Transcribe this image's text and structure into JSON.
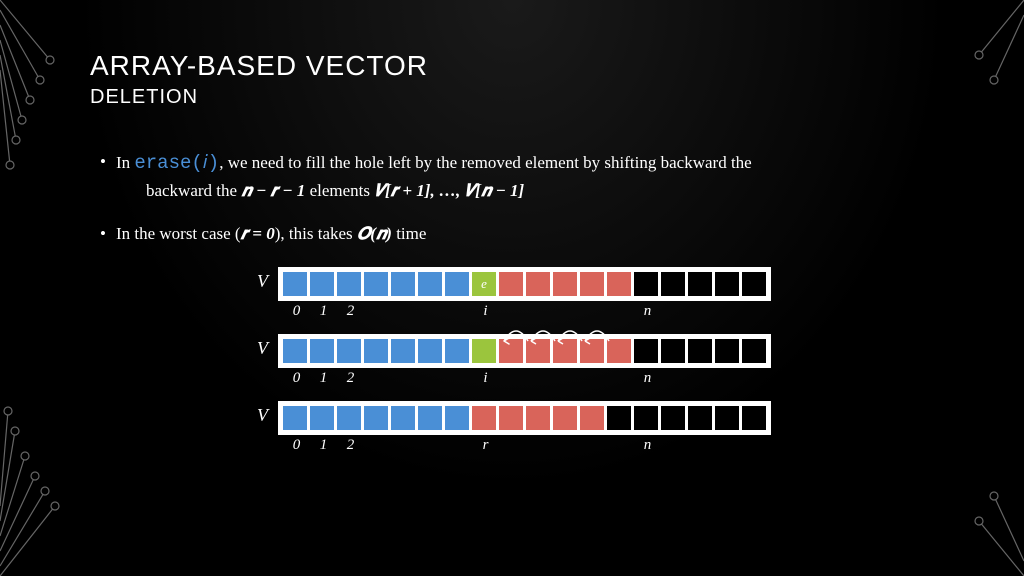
{
  "title": "ARRAY-BASED VECTOR",
  "subtitle": "DELETION",
  "bullets": [
    {
      "prefix": "In ",
      "erase": "erase(𝑖)",
      "mid": ", we need to fill the hole left by the removed element by shifting backward the ",
      "expr1": "𝒏 − 𝒓 − 1",
      "mid2": " elements ",
      "expr2": "𝑽[𝒓 + 1], …, 𝑽[𝒏 − 1]"
    },
    {
      "text1": "In the worst case (",
      "expr1": "𝒓 = 0",
      "text2": "), this takes ",
      "expr2": "𝑶(𝒏)",
      "text3": " time"
    }
  ],
  "arrays": {
    "row1": {
      "label": "V",
      "cells": [
        {
          "c": "blue"
        },
        {
          "c": "blue"
        },
        {
          "c": "blue"
        },
        {
          "c": "blue"
        },
        {
          "c": "blue"
        },
        {
          "c": "blue"
        },
        {
          "c": "blue"
        },
        {
          "c": "green",
          "t": "e"
        },
        {
          "c": "red"
        },
        {
          "c": "red"
        },
        {
          "c": "red"
        },
        {
          "c": "red"
        },
        {
          "c": "red"
        },
        {
          "c": ""
        },
        {
          "c": ""
        },
        {
          "c": ""
        },
        {
          "c": ""
        },
        {
          "c": ""
        }
      ],
      "indices": [
        "0",
        "1",
        "2",
        "",
        "",
        "",
        "",
        "i",
        "",
        "",
        "",
        "",
        "",
        "n",
        "",
        "",
        "",
        ""
      ]
    },
    "row2": {
      "label": "V",
      "cells": [
        {
          "c": "blue"
        },
        {
          "c": "blue"
        },
        {
          "c": "blue"
        },
        {
          "c": "blue"
        },
        {
          "c": "blue"
        },
        {
          "c": "blue"
        },
        {
          "c": "blue"
        },
        {
          "c": "green"
        },
        {
          "c": "red"
        },
        {
          "c": "red"
        },
        {
          "c": "red"
        },
        {
          "c": "red"
        },
        {
          "c": "red"
        },
        {
          "c": ""
        },
        {
          "c": ""
        },
        {
          "c": ""
        },
        {
          "c": ""
        },
        {
          "c": ""
        }
      ],
      "indices": [
        "0",
        "1",
        "2",
        "",
        "",
        "",
        "",
        "i",
        "",
        "",
        "",
        "",
        "",
        "n",
        "",
        "",
        "",
        ""
      ]
    },
    "row3": {
      "label": "V",
      "cells": [
        {
          "c": "blue"
        },
        {
          "c": "blue"
        },
        {
          "c": "blue"
        },
        {
          "c": "blue"
        },
        {
          "c": "blue"
        },
        {
          "c": "blue"
        },
        {
          "c": "blue"
        },
        {
          "c": "red"
        },
        {
          "c": "red"
        },
        {
          "c": "red"
        },
        {
          "c": "red"
        },
        {
          "c": "red"
        },
        {
          "c": ""
        },
        {
          "c": ""
        },
        {
          "c": ""
        },
        {
          "c": ""
        },
        {
          "c": ""
        },
        {
          "c": ""
        }
      ],
      "indices": [
        "0",
        "1",
        "2",
        "",
        "",
        "",
        "",
        "r",
        "",
        "",
        "",
        "",
        "",
        "n",
        "",
        "",
        "",
        ""
      ]
    }
  }
}
